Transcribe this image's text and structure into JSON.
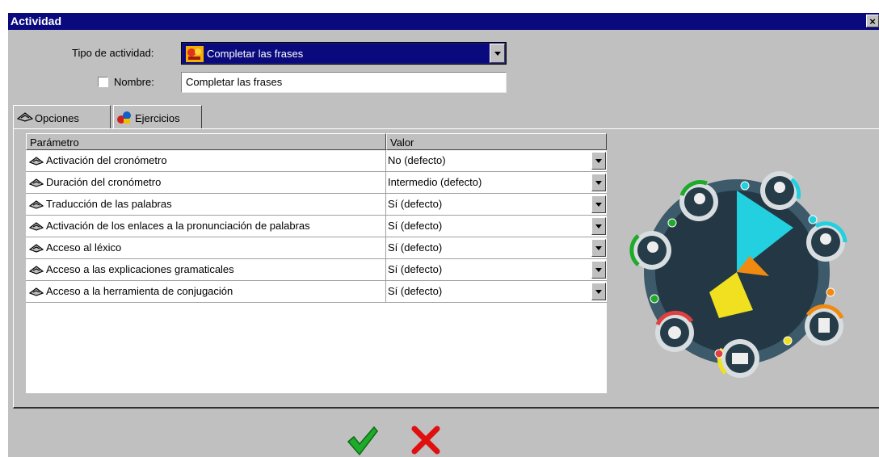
{
  "window": {
    "title": "Actividad",
    "close": "×"
  },
  "form": {
    "activity_type_label": "Tipo de actividad:",
    "activity_type_value": "Completar las frases",
    "name_label": "Nombre:",
    "name_value": "Completar las frases",
    "name_checked": false
  },
  "tabs": [
    {
      "label": "Opciones",
      "icon": "options-icon",
      "active": true
    },
    {
      "label": "Ejercicios",
      "icon": "exercises-icon",
      "active": false
    }
  ],
  "table": {
    "columns": [
      "Parámetro",
      "Valor"
    ],
    "rows": [
      {
        "param": "Activación del cronómetro",
        "value": "No (defecto)"
      },
      {
        "param": "Duración del cronómetro",
        "value": "Intermedio (defecto)"
      },
      {
        "param": "Traducción de las palabras",
        "value": "Sí (defecto)"
      },
      {
        "param": "Activación de los enlaces a la pronunciación de palabras",
        "value": "Sí (defecto)"
      },
      {
        "param": "Acceso al léxico",
        "value": "Sí (defecto)"
      },
      {
        "param": "Acceso a las explicaciones gramaticales",
        "value": "Sí (defecto)"
      },
      {
        "param": "Acceso a la herramienta de conjugación",
        "value": "Sí (defecto)"
      }
    ]
  },
  "skills_wheel": {
    "icons": [
      "listening-icon",
      "speaking-icon",
      "pronunciation-icon",
      "writing-icon",
      "reading-icon",
      "culture-icon",
      "oral-icon"
    ],
    "colors": {
      "cyan": "#22d0e0",
      "orange": "#f08a10",
      "yellow": "#f0e020",
      "green": "#1faa2a",
      "red": "#e04040",
      "dark": "#2f4858"
    }
  },
  "actions": {
    "ok_icon": "checkmark-icon",
    "cancel_icon": "cross-icon"
  }
}
